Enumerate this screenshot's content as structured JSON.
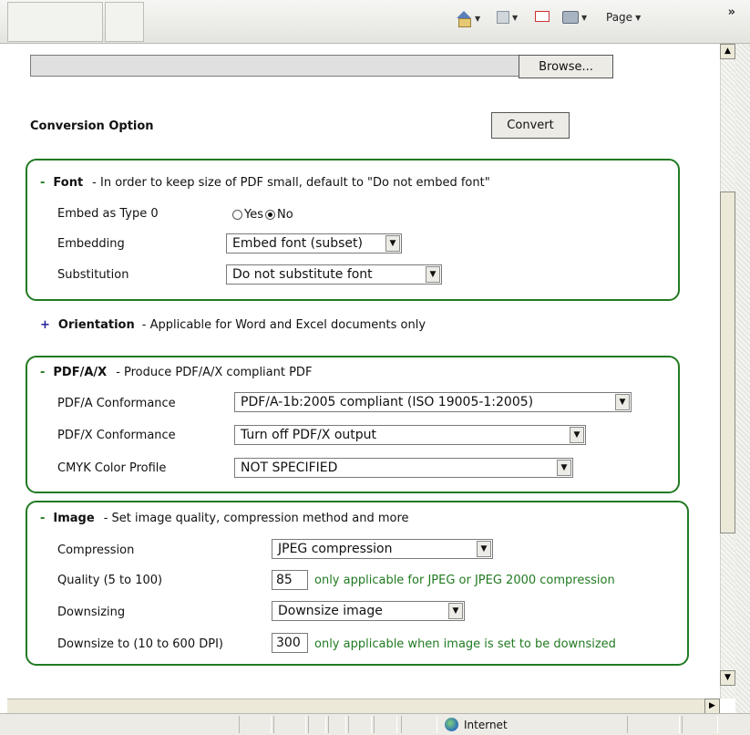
{
  "toolbar": {
    "icons": [
      "home-icon",
      "feeds-icon",
      "mail-icon",
      "print-icon"
    ],
    "page_label": "Page",
    "more_label": "»"
  },
  "upload": {
    "file_value": "",
    "browse_label": "Browse..."
  },
  "conversion": {
    "title": "Conversion Option",
    "convert_label": "Convert"
  },
  "font_group": {
    "sign": "-",
    "name": "Font",
    "desc": "- In order to keep size of PDF small, default to \"Do not embed font\"",
    "embed_type0_label": "Embed as Type 0",
    "radio_yes": "Yes",
    "radio_no": "No",
    "selected": "No",
    "embedding_label": "Embedding",
    "embedding_value": "Embed font (subset)",
    "substitution_label": "Substitution",
    "substitution_value": "Do not substitute font"
  },
  "orientation_group": {
    "sign": "+",
    "name": "Orientation",
    "desc": "- Applicable for Word and Excel documents only"
  },
  "pdfax_group": {
    "sign": "-",
    "name": "PDF/A/X",
    "desc": "- Produce PDF/A/X compliant PDF",
    "pdfa_label": "PDF/A Conformance",
    "pdfa_value": "PDF/A-1b:2005 compliant (ISO 19005-1:2005)",
    "pdfx_label": "PDF/X Conformance",
    "pdfx_value": "Turn off PDF/X output",
    "cmyk_label": "CMYK Color Profile",
    "cmyk_value": "NOT SPECIFIED"
  },
  "image_group": {
    "sign": "-",
    "name": "Image",
    "desc": "- Set image quality, compression method and more",
    "compression_label": "Compression",
    "compression_value": "JPEG compression",
    "quality_label": "Quality (5 to 100)",
    "quality_value": "85",
    "quality_hint": "only applicable for JPEG or JPEG 2000 compression",
    "downsizing_label": "Downsizing",
    "downsizing_value": "Downsize image",
    "downsize_to_label": "Downsize to (10 to 600 DPI)",
    "downsize_to_value": "300",
    "downsize_hint": "only applicable when image is set to be downsized"
  },
  "status": {
    "zone": "Internet"
  }
}
